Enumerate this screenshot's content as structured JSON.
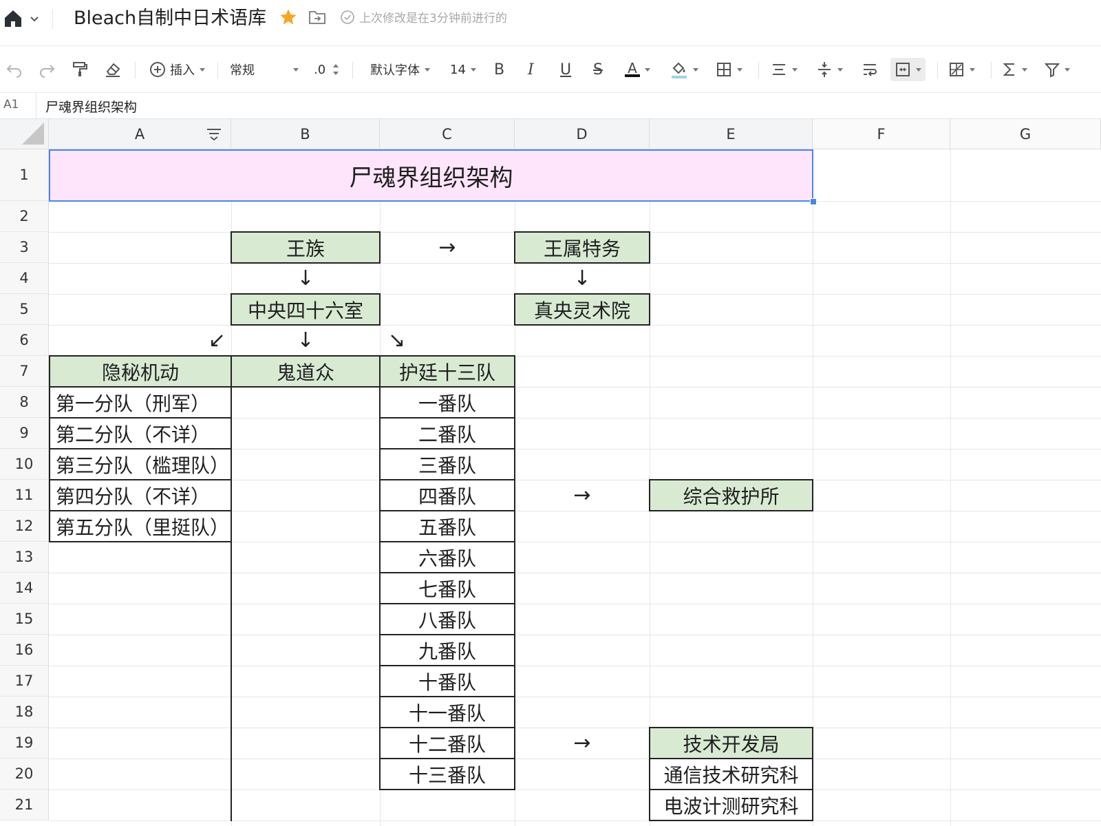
{
  "doc": {
    "title": "Bleach自制中日术语库",
    "status": "上次修改是在3分钟前进行的",
    "colors": {
      "title_fill": "#ffe5fb",
      "green_fill": "#d9ead3",
      "selection": "#4a86e8",
      "star": "#f5a623"
    }
  },
  "toolbar": {
    "insert": "插入",
    "number_format": "常规",
    "decimal": ".0",
    "font": "默认字体",
    "font_size": "14",
    "bold": "B",
    "italic": "I",
    "underline": "U",
    "strike": "S",
    "font_color_label": "A"
  },
  "formula": {
    "ref": "A1",
    "value": "尸魂界组织架构"
  },
  "columns": [
    "A",
    "B",
    "C",
    "D",
    "E",
    "F",
    "G"
  ],
  "rows": [
    "1",
    "2",
    "3",
    "4",
    "5",
    "6",
    "7",
    "8",
    "9",
    "10",
    "11",
    "12",
    "13",
    "14",
    "15",
    "16",
    "17",
    "18",
    "19",
    "20",
    "21"
  ],
  "sheet": {
    "title": "尸魂界组织架构",
    "royal": "王族",
    "royal_guard": "王属特务",
    "central46": "中央四十六室",
    "academy": "真央灵术院",
    "arrow_right": "→",
    "arrow_down": "↓",
    "arrow_down_left": "↙",
    "arrow_down_right": "↘",
    "onmitsu": "隐秘机动",
    "kido": "鬼道众",
    "gotei": "护廷十三队",
    "onmitsu_units": [
      "第一分队（刑军）",
      "第二分队（不详）",
      "第三分队（槛理队）",
      "第四分队（不详）",
      "第五分队（里挺队）"
    ],
    "divisions": [
      "一番队",
      "二番队",
      "三番队",
      "四番队",
      "五番队",
      "六番队",
      "七番队",
      "八番队",
      "九番队",
      "十番队",
      "十一番队",
      "十二番队",
      "十三番队"
    ],
    "relief": "综合救护所",
    "sdri": "技术开发局",
    "sdri_units": [
      "通信技术研究科",
      "电波计测研究科"
    ]
  }
}
